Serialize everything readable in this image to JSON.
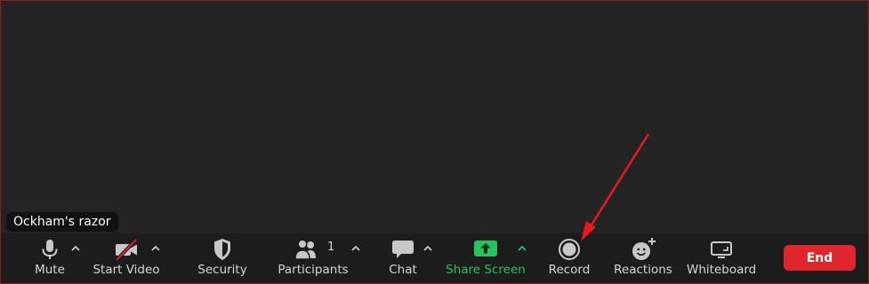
{
  "name_tag": "Ockham's razor",
  "toolbar": {
    "mute": {
      "label": "Mute",
      "icon": "microphone-icon"
    },
    "start_video": {
      "label": "Start Video",
      "icon": "video-camera-off-icon"
    },
    "security": {
      "label": "Security",
      "icon": "shield-icon"
    },
    "participants": {
      "label": "Participants",
      "icon": "participants-icon",
      "count": "1"
    },
    "chat": {
      "label": "Chat",
      "icon": "chat-bubble-icon"
    },
    "share_screen": {
      "label": "Share Screen",
      "icon": "share-screen-icon"
    },
    "record": {
      "label": "Record",
      "icon": "record-icon"
    },
    "reactions": {
      "label": "Reactions",
      "icon": "reaction-smiley-icon"
    },
    "whiteboard": {
      "label": "Whiteboard",
      "icon": "whiteboard-icon"
    },
    "end_label": "End"
  },
  "colors": {
    "background": "#232323",
    "toolbar": "#1c1c1c",
    "icon": "#c8c8c8",
    "accent_green": "#22c55e",
    "end_red": "#e0262d",
    "annotation_red": "#e8191c"
  }
}
